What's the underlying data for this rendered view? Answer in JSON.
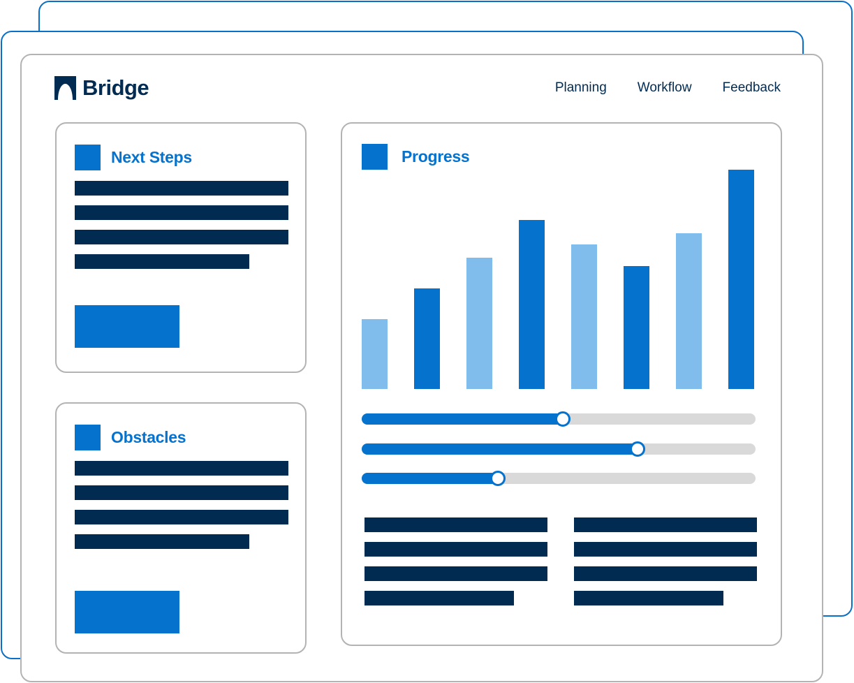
{
  "app": {
    "name": "Bridge"
  },
  "nav": {
    "items": [
      "Planning",
      "Workflow",
      "Feedback"
    ]
  },
  "cards": {
    "next_steps": {
      "title": "Next Steps"
    },
    "obstacles": {
      "title": "Obstacles"
    },
    "progress": {
      "title": "Progress"
    }
  },
  "colors": {
    "accent": "#0572cd",
    "accent_light": "#80bcec",
    "navy": "#022b52",
    "track": "#d9d9d9",
    "back_window_border": "#0a6fc9",
    "card_border": "#b3b3b3"
  },
  "chart_data": {
    "type": "bar",
    "values": [
      32,
      46,
      60,
      77,
      66,
      56,
      71,
      100
    ],
    "ylim": [
      0,
      100
    ],
    "bar_colors": [
      "light",
      "dark",
      "light",
      "dark",
      "light",
      "dark",
      "light",
      "dark"
    ]
  },
  "sliders": [
    {
      "value": 0.51
    },
    {
      "value": 0.7
    },
    {
      "value": 0.345
    }
  ]
}
